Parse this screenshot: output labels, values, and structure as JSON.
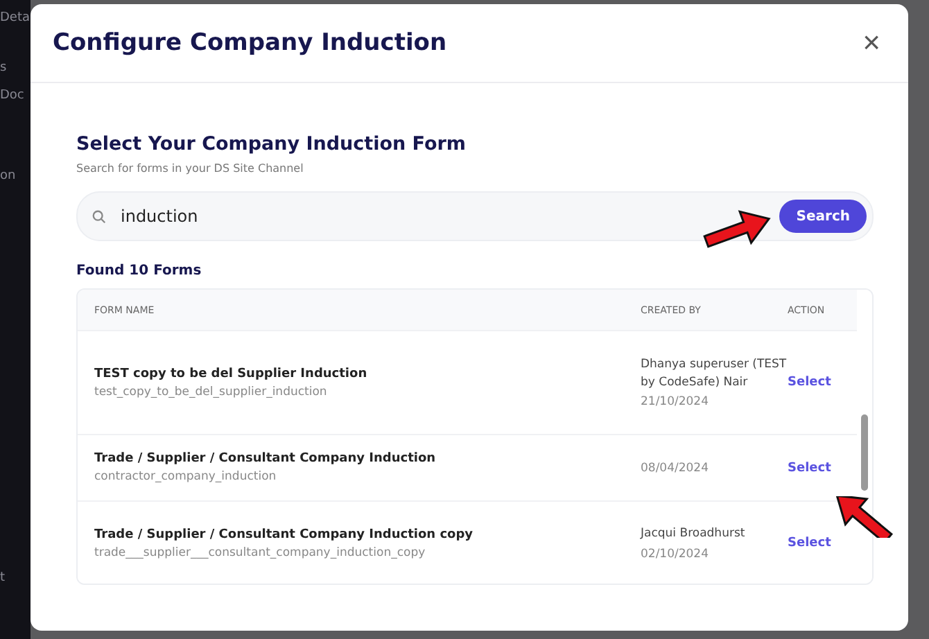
{
  "sidebar": {
    "items": [
      "Deta",
      "s",
      "Doc",
      "on",
      "t"
    ]
  },
  "dialog": {
    "title": "Configure Company Induction",
    "close": "×",
    "heading": "Select Your Company Induction Form",
    "hint": "Search for forms in your DS Site Channel",
    "search": {
      "value": "induction",
      "button": "Search"
    },
    "result_count": "Found 10 Forms",
    "table": {
      "columns": [
        "FORM NAME",
        "CREATED BY",
        "ACTION"
      ],
      "rows": [
        {
          "name": "TEST copy to be del Supplier Induction",
          "slug": "test_copy_to_be_del_supplier_induction",
          "creator": "Dhanya superuser (TEST by CodeSafe) Nair",
          "date": "21/10/2024",
          "action": "Select"
        },
        {
          "name": "Trade / Supplier / Consultant Company Induction",
          "slug": "contractor_company_induction",
          "date": "08/04/2024",
          "action": "Select"
        },
        {
          "name": "Trade / Supplier / Consultant Company Induction copy",
          "slug": "trade___supplier___consultant_company_induction_copy",
          "creator": "Jacqui Broadhurst",
          "date": "02/10/2024",
          "action": "Select"
        }
      ]
    }
  }
}
